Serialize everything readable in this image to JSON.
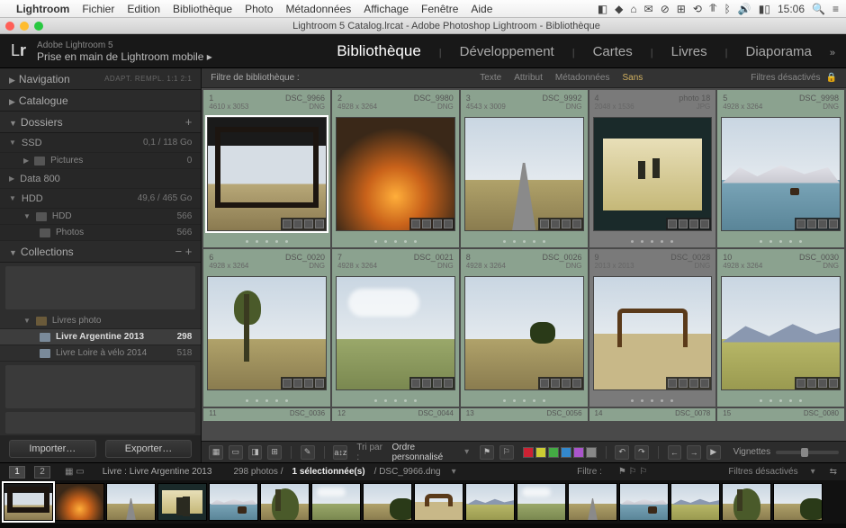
{
  "menubar": {
    "app": "Lightroom",
    "items": [
      "Fichier",
      "Edition",
      "Bibliothèque",
      "Photo",
      "Métadonnées",
      "Affichage",
      "Fenêtre",
      "Aide"
    ],
    "clock": "15:06"
  },
  "titlebar": {
    "title": "Lightroom 5 Catalog.lrcat - Adobe Photoshop Lightroom - Bibliothèque"
  },
  "identity": {
    "product": "Adobe Lightroom 5",
    "subtitle": "Prise en main de Lightroom mobile  ▸",
    "modules": [
      "Bibliothèque",
      "Développement",
      "Cartes",
      "Livres",
      "Diaporama"
    ],
    "active_module": 0
  },
  "left": {
    "nav": {
      "label": "Navigation",
      "opts": "ADAPT.   REMPL.   1:1   2:1"
    },
    "catalogue": "Catalogue",
    "dossiers": "Dossiers",
    "ssd": {
      "label": "SSD",
      "val": "0,1 / 118 Go"
    },
    "pictures": {
      "label": "Pictures",
      "val": "0"
    },
    "data800": "Data 800",
    "hdd_vol": {
      "label": "HDD",
      "val": "49,6 / 465 Go"
    },
    "hdd": {
      "label": "HDD",
      "val": "566"
    },
    "photos": {
      "label": "Photos",
      "val": "566"
    },
    "collections": "Collections",
    "livres_photo": "Livres photo",
    "coll_a": {
      "label": "Livre Argentine 2013",
      "val": "298"
    },
    "coll_b": {
      "label": "Livre Loire à vélo 2014",
      "val": "518"
    },
    "btn_import": "Importer…",
    "btn_export": "Exporter…"
  },
  "filter": {
    "label": "Filtre de bibliothèque :",
    "tabs": [
      "Texte",
      "Attribut",
      "Métadonnées",
      "Sans"
    ],
    "active": 3,
    "right": "Filtres désactivés"
  },
  "grid": [
    {
      "n": "1",
      "name": "DSC_9966",
      "dim": "4610 x 3053",
      "fmt": "DNG",
      "selected": true,
      "scene": "window"
    },
    {
      "n": "2",
      "name": "DSC_9980",
      "dim": "4928 x 3264",
      "fmt": "DNG",
      "scene": "fire"
    },
    {
      "n": "3",
      "name": "DSC_9992",
      "dim": "4543 x 3009",
      "fmt": "DNG",
      "scene": "road"
    },
    {
      "n": "4",
      "name": "photo 18",
      "dim": "2048 x 1536",
      "fmt": "JPG",
      "scene": "postcard",
      "gray": true
    },
    {
      "n": "5",
      "name": "DSC_9998",
      "dim": "4928 x 3264",
      "fmt": "DNG",
      "scene": "lake"
    },
    {
      "n": "6",
      "name": "DSC_0020",
      "dim": "4928 x 3264",
      "fmt": "DNG",
      "scene": "tree"
    },
    {
      "n": "7",
      "name": "DSC_0021",
      "dim": "4928 x 3264",
      "fmt": "DNG",
      "scene": "plain"
    },
    {
      "n": "8",
      "name": "DSC_0026",
      "dim": "4928 x 3264",
      "fmt": "DNG",
      "scene": "bush"
    },
    {
      "n": "9",
      "name": "DSC_0028",
      "dim": "2013 x 2013",
      "fmt": "DNG",
      "scene": "gate",
      "gray": true
    },
    {
      "n": "10",
      "name": "DSC_0030",
      "dim": "4928 x 3264",
      "fmt": "DNG",
      "scene": "field"
    }
  ],
  "grid_stubs": [
    {
      "n": "11",
      "name": "DSC_0036"
    },
    {
      "n": "12",
      "name": "DSC_0044"
    },
    {
      "n": "13",
      "name": "DSC_0056"
    },
    {
      "n": "14",
      "name": "DSC_0078"
    },
    {
      "n": "15",
      "name": "DSC_0080"
    }
  ],
  "toolbar": {
    "tri_label": "Tri par :",
    "tri_value": "Ordre personnalisé",
    "vignettes": "Vignettes",
    "colors": [
      "#c23",
      "#cc3",
      "#4a4",
      "#38c",
      "#a5c",
      "#888"
    ]
  },
  "status": {
    "pages": [
      "1",
      "2"
    ],
    "breadcrumb": "Livre : Livre Argentine 2013",
    "count": "298 photos /",
    "sel": "1 sélectionnée(s)",
    "file": "/ DSC_9966.dng",
    "filter_label": "Filtre :",
    "right": "Filtres désactivés"
  },
  "film_count": 16
}
